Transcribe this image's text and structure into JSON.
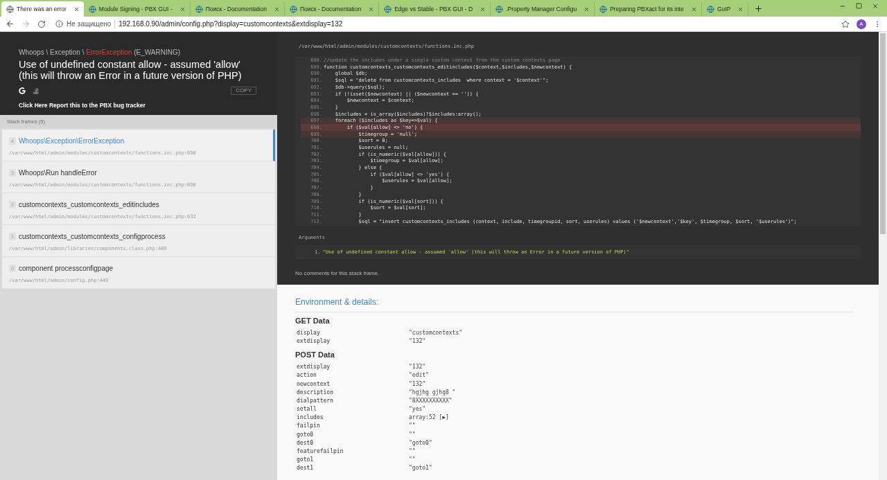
{
  "browser": {
    "tabs": [
      {
        "title": "There was an error",
        "selected": true
      },
      {
        "title": "Module Signing - PBX GUI -",
        "selected": false
      },
      {
        "title": "Поиск - Documentation",
        "selected": false
      },
      {
        "title": "Поиск - Documentation",
        "selected": false
      },
      {
        "title": "Edge vs Stable - PBX GUI - D",
        "selected": false
      },
      {
        "title": ".Property Manager Configu",
        "selected": false
      },
      {
        "title": "Preparing PBXact for its inte",
        "selected": false
      },
      {
        "title": "GoIP",
        "selected": false
      }
    ],
    "security": "Не защищено",
    "url": "192.168.0.90/admin/config.php?display=customcontexts&extdisplay=132",
    "avatar": "A"
  },
  "error": {
    "path": "Whoops \\ Exception \\",
    "type": "ErrorException",
    "code": "(E_WARNING)",
    "message": "Use of undefined constant allow - assumed 'allow' (this will throw an Error in a future version of PHP)",
    "copy": "COPY",
    "report": "Click Here Report this to the PBX bug tracker"
  },
  "stack": {
    "title": "Stack frames (5)",
    "frames": [
      {
        "index": "4",
        "name": "Whoops\\Exception\\ErrorException",
        "file": "/var/www/html/admin/modules/customcontexts/functions.inc.php:698",
        "selected": true
      },
      {
        "index": "3",
        "name": "Whoops\\Run handleError",
        "file": "/var/www/html/admin/modules/customcontexts/functions.inc.php:698",
        "selected": false
      },
      {
        "index": "2",
        "name": "customcontexts_customcontexts_editincludes",
        "file": "/var/www/html/admin/modules/customcontexts/functions.inc.php:632",
        "selected": false
      },
      {
        "index": "1",
        "name": "customcontexts_customcontexts_configprocess",
        "file": "/var/www/html/admin/libraries/components.class.php:469",
        "selected": false
      },
      {
        "index": "0",
        "name": "component processconfigpage",
        "file": "/var/www/html/admin/config.php:449",
        "selected": false
      }
    ]
  },
  "code": {
    "file": "/var/www/html/admin/modules/customcontexts/functions.inc.php",
    "lines": [
      {
        "no": "688.",
        "text": "//update the includes under a single custom context from the custom contexts page",
        "kind": "comment",
        "near": false,
        "error": false
      },
      {
        "no": "689.",
        "text": "function customcontexts_customcontexts_editincludes($context,$includes,$newcontext) {",
        "kind": "code",
        "near": false,
        "error": false
      },
      {
        "no": "690.",
        "text": "    global $db;",
        "kind": "code",
        "near": false,
        "error": false
      },
      {
        "no": "691.",
        "text": "    $sql = \"delete from customcontexts_includes  where context = '$context'\";",
        "kind": "code",
        "near": false,
        "error": false
      },
      {
        "no": "692.",
        "text": "    $db->query($sql);",
        "kind": "code",
        "near": false,
        "error": false
      },
      {
        "no": "693.",
        "text": "    if (!isset($newcontext) || ($newcontext == '')) {",
        "kind": "code",
        "near": false,
        "error": false
      },
      {
        "no": "694.",
        "text": "        $newcontext = $context;",
        "kind": "code",
        "near": false,
        "error": false
      },
      {
        "no": "695.",
        "text": "    }",
        "kind": "code",
        "near": false,
        "error": false
      },
      {
        "no": "696.",
        "text": "    $includes = is_array($includes)?$includes:array();",
        "kind": "code",
        "near": false,
        "error": false
      },
      {
        "no": "697.",
        "text": "    foreach ($includes as $key=>$val) {",
        "kind": "code",
        "near": true,
        "error": false
      },
      {
        "no": "698.",
        "text": "        if ($val[allow] <> 'no') {",
        "kind": "code",
        "near": false,
        "error": true
      },
      {
        "no": "699.",
        "text": "            $timegroup = 'null';",
        "kind": "code",
        "near": true,
        "error": false
      },
      {
        "no": "700.",
        "text": "            $sort = 0;",
        "kind": "code",
        "near": false,
        "error": false
      },
      {
        "no": "701.",
        "text": "            $userules = null;",
        "kind": "code",
        "near": false,
        "error": false
      },
      {
        "no": "702.",
        "text": "            if (is_numeric($val[allow])) {",
        "kind": "code",
        "near": false,
        "error": false
      },
      {
        "no": "703.",
        "text": "                $timegroup = $val[allow];",
        "kind": "code",
        "near": false,
        "error": false
      },
      {
        "no": "704.",
        "text": "            } else {",
        "kind": "code",
        "near": false,
        "error": false
      },
      {
        "no": "705.",
        "text": "                if ($val[allow] <> 'yes') {",
        "kind": "code",
        "near": false,
        "error": false
      },
      {
        "no": "706.",
        "text": "                    $userules = $val[allow];",
        "kind": "code",
        "near": false,
        "error": false
      },
      {
        "no": "707.",
        "text": "                }",
        "kind": "code",
        "near": false,
        "error": false
      },
      {
        "no": "708.",
        "text": "            }",
        "kind": "code",
        "near": false,
        "error": false
      },
      {
        "no": "709.",
        "text": "            if (is_numeric($val[sort])) {",
        "kind": "code",
        "near": false,
        "error": false
      },
      {
        "no": "710.",
        "text": "                $sort = $val[sort];",
        "kind": "code",
        "near": false,
        "error": false
      },
      {
        "no": "711.",
        "text": "            }",
        "kind": "code",
        "near": false,
        "error": false
      },
      {
        "no": "712.",
        "text": "            $sql = \"insert customcontexts_includes (context, include, timegroupid, sort, userules) values ('$newcontext','$key', $timegroup, $sort, '$userules')\";",
        "kind": "code",
        "near": false,
        "error": false
      }
    ]
  },
  "arguments": {
    "title": "Arguments",
    "items": [
      {
        "no": "1.",
        "text": "\"Use of undefined constant allow - assumed 'allow' (this will throw an Error in a future version of PHP)\""
      }
    ]
  },
  "comments": "No comments for this stack frame.",
  "environment": {
    "title": "Environment & details:",
    "sections": [
      {
        "title": "GET Data",
        "rows": [
          {
            "key": "display",
            "value": "\"customcontexts\""
          },
          {
            "key": "extdisplay",
            "value": "\"132\""
          }
        ]
      },
      {
        "title": "POST Data",
        "rows": [
          {
            "key": "extdisplay",
            "value": "\"132\""
          },
          {
            "key": "action",
            "value": "\"edit\""
          },
          {
            "key": "newcontext",
            "value": "\"132\""
          },
          {
            "key": "description",
            "value": "\"hgjhg gjhg8 \""
          },
          {
            "key": "dialpattern",
            "value": "\"8XXXXXXXXXX\""
          },
          {
            "key": "setall",
            "value": "\"yes\""
          },
          {
            "key": "includes",
            "value": "array:52 [▶]"
          },
          {
            "key": "failpin",
            "value": "\"\""
          },
          {
            "key": "goto0",
            "value": "\"\""
          },
          {
            "key": "dest0",
            "value": "\"goto0\""
          },
          {
            "key": "featurefailpin",
            "value": "\"\""
          },
          {
            "key": "goto1",
            "value": "\"\""
          },
          {
            "key": "dest1",
            "value": "\"goto1\""
          }
        ]
      }
    ]
  }
}
